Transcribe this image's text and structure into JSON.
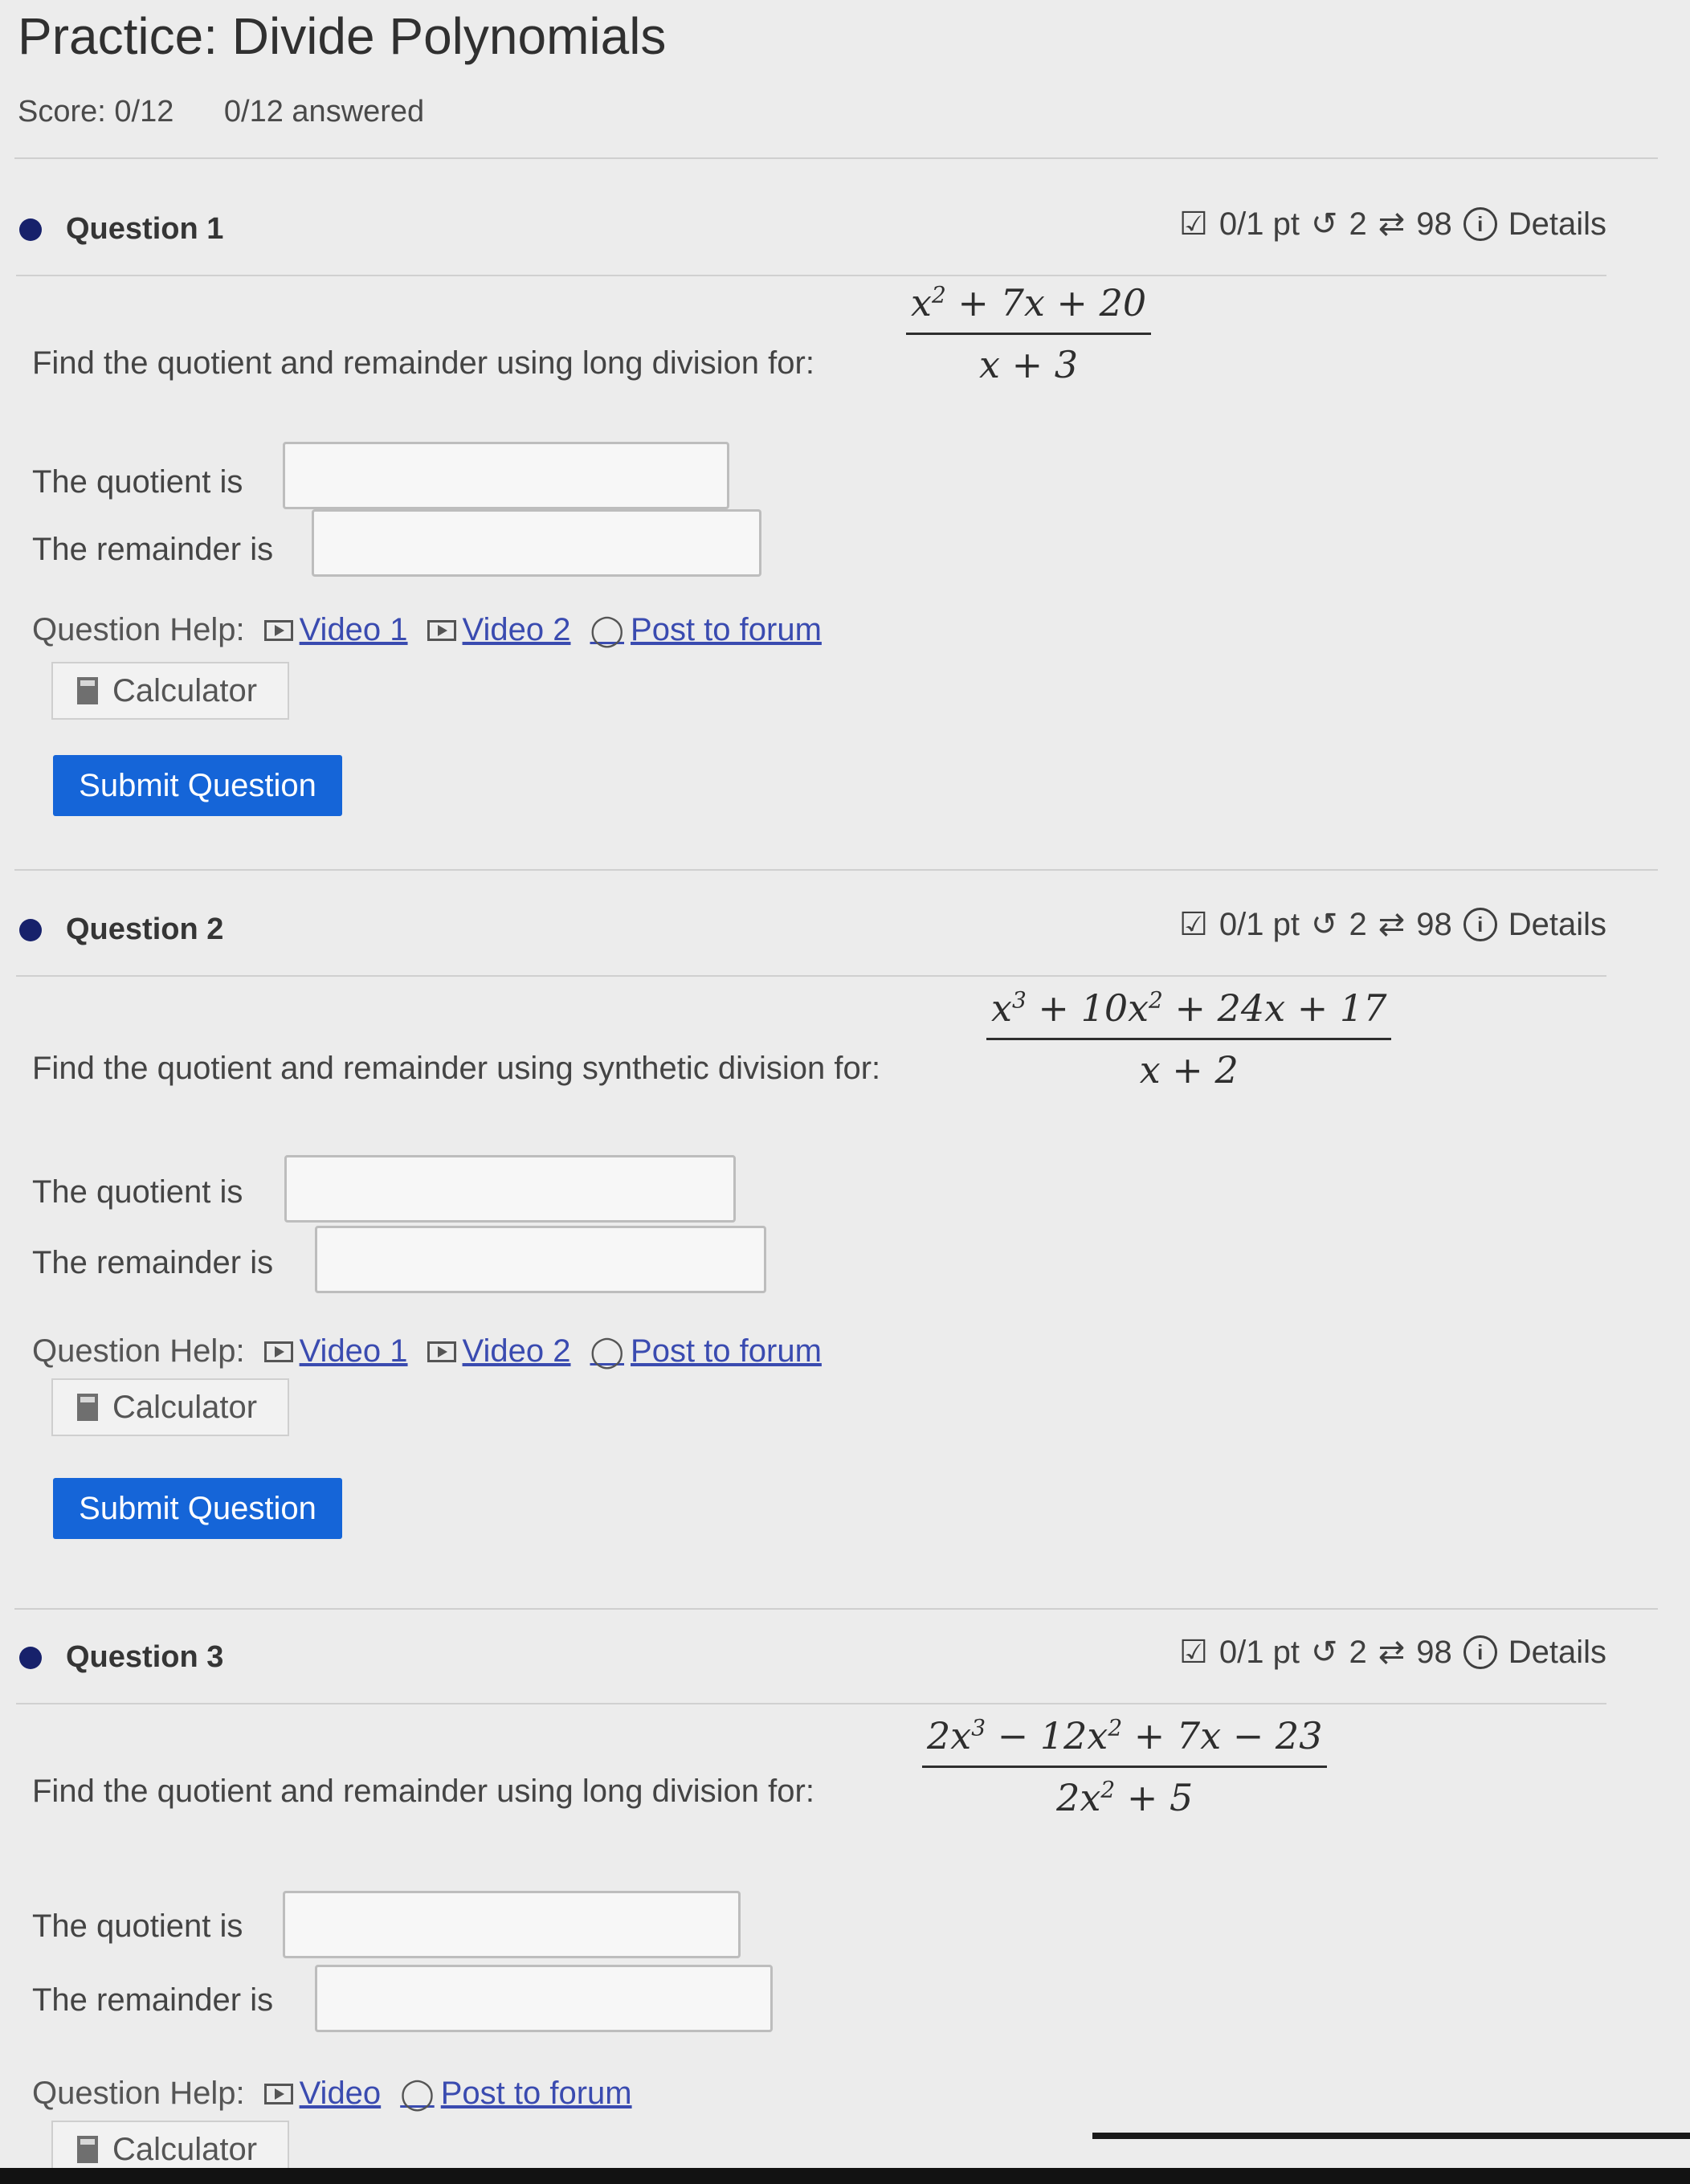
{
  "page": {
    "title": "Practice: Divide Polynomials",
    "score": "Score: 0/12",
    "answered": "0/12 answered"
  },
  "colors": {
    "accent": "#1565d8",
    "bullet": "#17216b",
    "link": "#3a4bb0"
  },
  "questions": [
    {
      "label": "Question 1",
      "points": "0/1 pt",
      "retries": "2",
      "versions": "98",
      "details": "Details",
      "prompt": "Find the quotient and remainder using long division for:",
      "numerator_html": "x<sup>2</sup> + 7x + 20",
      "denominator_html": "x + 3",
      "quotient_label": "The quotient is",
      "remainder_label": "The remainder is",
      "quotient_value": "",
      "remainder_value": "",
      "help_label": "Question Help:",
      "help_links": [
        "Video 1",
        "Video 2",
        "Post to forum"
      ],
      "calculator": "Calculator",
      "submit": "Submit Question"
    },
    {
      "label": "Question 2",
      "points": "0/1 pt",
      "retries": "2",
      "versions": "98",
      "details": "Details",
      "prompt": "Find the quotient and remainder using synthetic division for:",
      "numerator_html": "x<sup>3</sup> + 10x<sup>2</sup> + 24x + 17",
      "denominator_html": "x + 2",
      "quotient_label": "The quotient is",
      "remainder_label": "The remainder is",
      "quotient_value": "",
      "remainder_value": "",
      "help_label": "Question Help:",
      "help_links": [
        "Video 1",
        "Video 2",
        "Post to forum"
      ],
      "calculator": "Calculator",
      "submit": "Submit Question"
    },
    {
      "label": "Question 3",
      "points": "0/1 pt",
      "retries": "2",
      "versions": "98",
      "details": "Details",
      "prompt": "Find the quotient and remainder using long division for:",
      "numerator_html": "2x<sup>3</sup> − 12x<sup>2</sup> + 7x − 23",
      "denominator_html": "2x<sup>2</sup> + 5",
      "quotient_label": "The quotient is",
      "remainder_label": "The remainder is",
      "quotient_value": "",
      "remainder_value": "",
      "help_label": "Question Help:",
      "help_links": [
        "Video",
        "Post to forum"
      ],
      "calculator": "Calculator"
    }
  ]
}
